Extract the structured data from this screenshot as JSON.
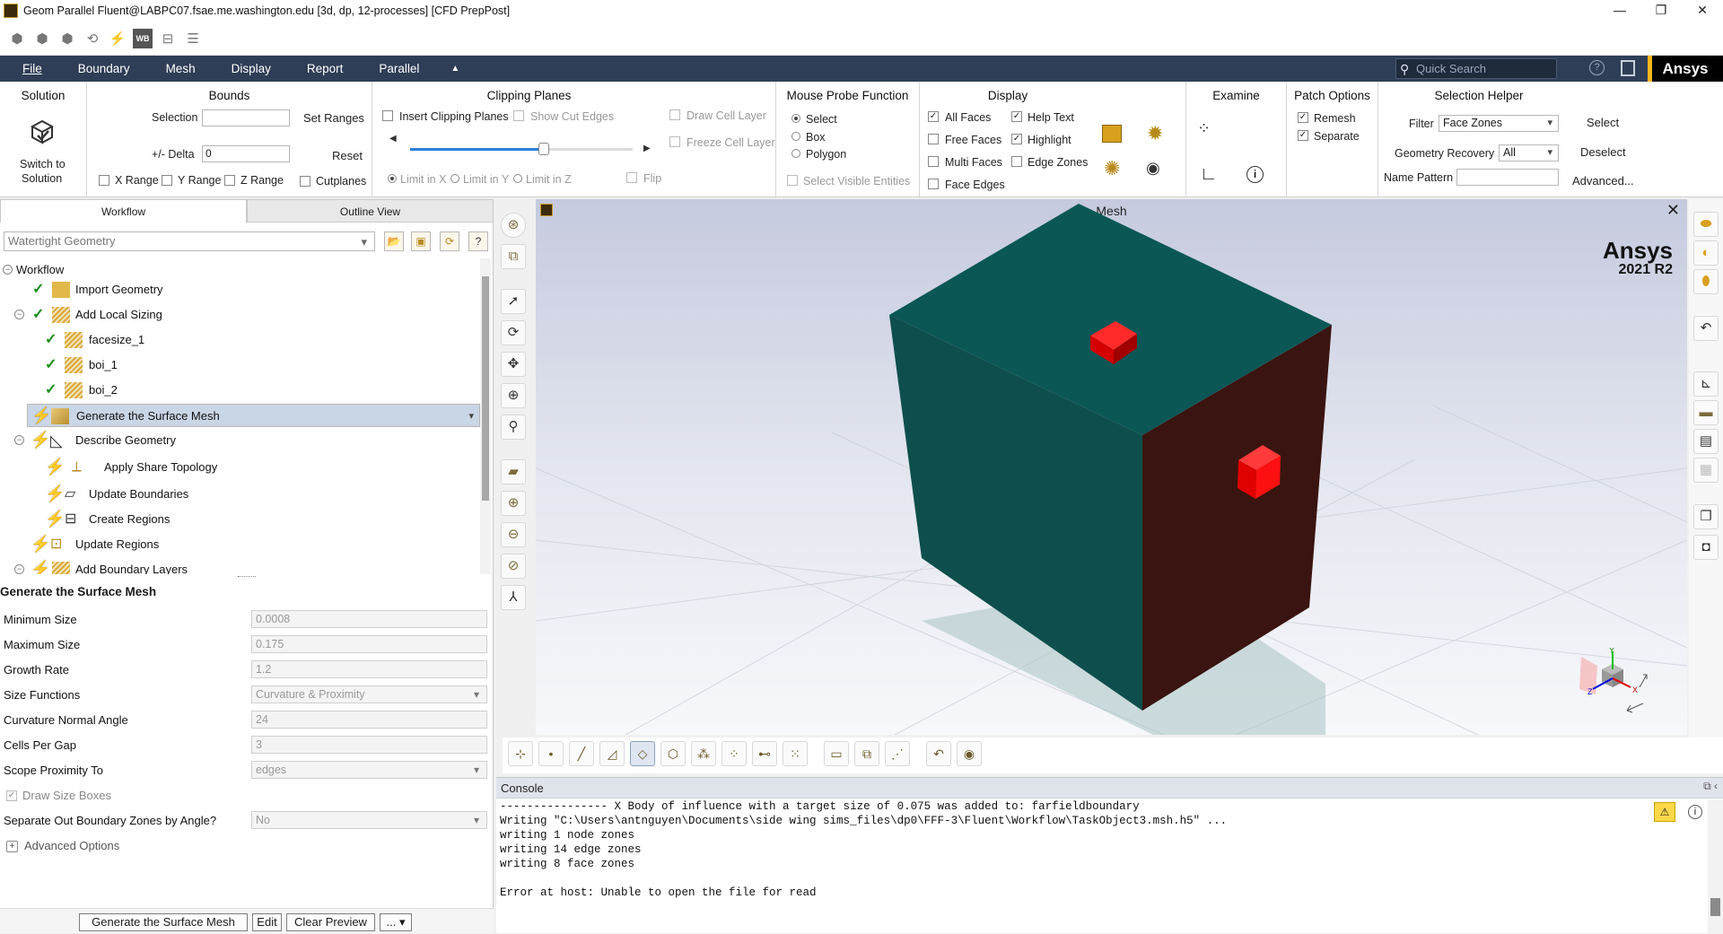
{
  "window": {
    "title": "Geom Parallel Fluent@LABPC07.fsae.me.washington.edu  [3d, dp, 12-processes] [CFD PrepPost]",
    "min": "—",
    "restore": "❐",
    "close": "✕"
  },
  "quick_toolbar": {
    "wb_label": "WB"
  },
  "menu": {
    "items": [
      "File",
      "Boundary",
      "Mesh",
      "Display",
      "Report",
      "Parallel"
    ],
    "collapse": "▲",
    "quick_search_placeholder": "Quick Search",
    "brand": "Ansys"
  },
  "ribbon": {
    "solution": {
      "title": "Solution",
      "switch_label_1": "Switch to",
      "switch_label_2": "Solution"
    },
    "bounds": {
      "title": "Bounds",
      "selection_label": "Selection",
      "set_ranges": "Set Ranges",
      "delta_label": "+/- Delta",
      "delta_value": "0",
      "reset": "Reset",
      "x_range": "X Range",
      "y_range": "Y Range",
      "z_range": "Z Range",
      "cutplanes": "Cutplanes"
    },
    "clipping": {
      "title": "Clipping Planes",
      "insert": "Insert Clipping Planes",
      "show_cut_edges": "Show Cut Edges",
      "draw_cell_layer": "Draw Cell Layer",
      "freeze_cell_layer": "Freeze Cell Layer",
      "limit_x": "Limit in X",
      "limit_y": "Limit in Y",
      "limit_z": "Limit in Z",
      "flip": "Flip",
      "slider_fraction": 0.6
    },
    "probe": {
      "title": "Mouse Probe Function",
      "select": "Select",
      "box": "Box",
      "polygon": "Polygon",
      "select_visible": "Select Visible Entities"
    },
    "display": {
      "title": "Display",
      "all_faces": "All Faces",
      "free_faces": "Free Faces",
      "multi_faces": "Multi Faces",
      "face_edges": "Face Edges",
      "help_text": "Help Text",
      "highlight": "Highlight",
      "edge_zones": "Edge Zones"
    },
    "examine": {
      "title": "Examine"
    },
    "patch": {
      "title": "Patch Options",
      "remesh": "Remesh",
      "separate": "Separate"
    },
    "helper": {
      "title": "Selection Helper",
      "filter_label": "Filter",
      "filter_value": "Face Zones",
      "select": "Select",
      "geom_recovery_label": "Geometry Recovery",
      "geom_recovery_value": "All",
      "deselect": "Deselect",
      "name_pattern_label": "Name Pattern",
      "advanced": "Advanced..."
    }
  },
  "left": {
    "tabs": [
      "Workflow",
      "Outline View"
    ],
    "workflow_select": "Watertight Geometry",
    "tree": {
      "root": "Workflow",
      "import": "Import Geometry",
      "local_sizing": "Add Local Sizing",
      "facesize": "facesize_1",
      "boi1": "boi_1",
      "boi2": "boi_2",
      "surface_mesh": "Generate the Surface Mesh",
      "describe": "Describe Geometry",
      "share_topo": "Apply Share Topology",
      "update_boundaries": "Update Boundaries",
      "create_regions": "Create Regions",
      "update_regions": "Update Regions",
      "boundary_layers": "Add Boundary Layers"
    },
    "task": {
      "title": "Generate the Surface Mesh",
      "min_size_label": "Minimum Size",
      "min_size": "0.0008",
      "max_size_label": "Maximum Size",
      "max_size": "0.175",
      "growth_label": "Growth Rate",
      "growth": "1.2",
      "size_fn_label": "Size Functions",
      "size_fn": "Curvature & Proximity",
      "curv_label": "Curvature Normal Angle",
      "curv": "24",
      "cells_label": "Cells Per Gap",
      "cells": "3",
      "scope_label": "Scope Proximity To",
      "scope": "edges",
      "draw_boxes": "Draw Size Boxes",
      "separate_label": "Separate Out Boundary Zones by Angle?",
      "separate": "No",
      "advanced": "Advanced Options"
    },
    "buttons": {
      "generate": "Generate the Surface Mesh",
      "edit": "Edit",
      "clear": "Clear Preview",
      "more": "... ▾"
    }
  },
  "graphics": {
    "title": "Mesh",
    "close": "✕",
    "brand": "Ansys",
    "version": "2021 R2",
    "triad": {
      "x": "X",
      "y": "Y",
      "z": "Z"
    }
  },
  "console": {
    "title": "Console",
    "lines": [
      "---------------- X Body of influence with a target size of 0.075 was added to: farfieldboundary",
      "Writing \"C:\\Users\\antnguyen\\Documents\\side wing sims_files\\dp0\\FFF-3\\Fluent\\Workflow\\TaskObject3.msh.h5\" ...",
      "writing 1 node zones",
      "writing 14 edge zones",
      "writing 8 face zones",
      "",
      "Error at host: Unable to open the file for read"
    ]
  }
}
